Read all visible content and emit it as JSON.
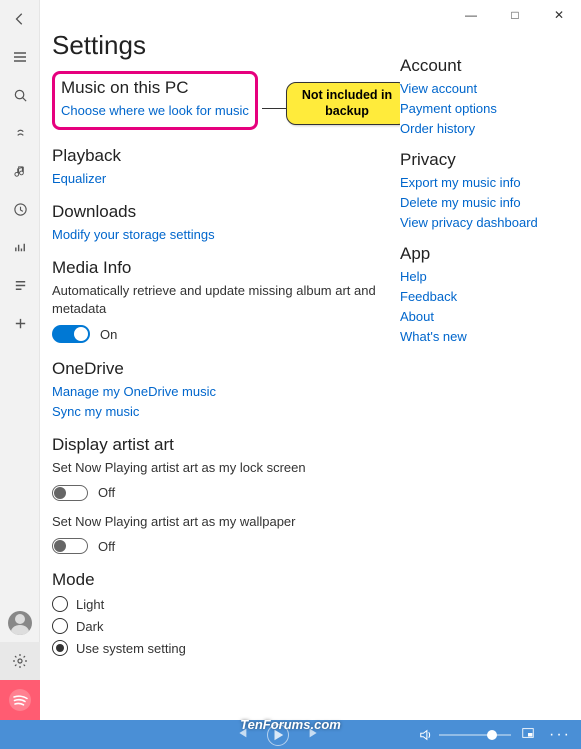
{
  "titlebar": {
    "min": "—",
    "max": "□",
    "close": "✕"
  },
  "sidebar": {
    "back": "←",
    "items": [
      "menu",
      "search",
      "explore",
      "music",
      "recent",
      "nowplaying",
      "playlists",
      "add"
    ]
  },
  "page": {
    "title": "Settings"
  },
  "callout": {
    "text": "Not included in backup"
  },
  "sections": {
    "music_pc": {
      "title": "Music on this PC",
      "link": "Choose where we look for music"
    },
    "playback": {
      "title": "Playback",
      "link": "Equalizer"
    },
    "downloads": {
      "title": "Downloads",
      "link": "Modify your storage settings"
    },
    "media_info": {
      "title": "Media Info",
      "desc": "Automatically retrieve and update missing album art and metadata",
      "toggle_state": "On"
    },
    "onedrive": {
      "title": "OneDrive",
      "link1": "Manage my OneDrive music",
      "link2": "Sync my music"
    },
    "artist_art": {
      "title": "Display artist art",
      "opt1_desc": "Set Now Playing artist art as my lock screen",
      "opt1_state": "Off",
      "opt2_desc": "Set Now Playing artist art as my wallpaper",
      "opt2_state": "Off"
    },
    "mode": {
      "title": "Mode",
      "options": [
        "Light",
        "Dark",
        "Use system setting"
      ],
      "selected": 2
    }
  },
  "right": {
    "account": {
      "title": "Account",
      "links": [
        "View account",
        "Payment options",
        "Order history"
      ]
    },
    "privacy": {
      "title": "Privacy",
      "links": [
        "Export my music info",
        "Delete my music info",
        "View privacy dashboard"
      ]
    },
    "app": {
      "title": "App",
      "links": [
        "Help",
        "Feedback",
        "About",
        "What's new"
      ]
    }
  },
  "watermark": "TenForums.com"
}
